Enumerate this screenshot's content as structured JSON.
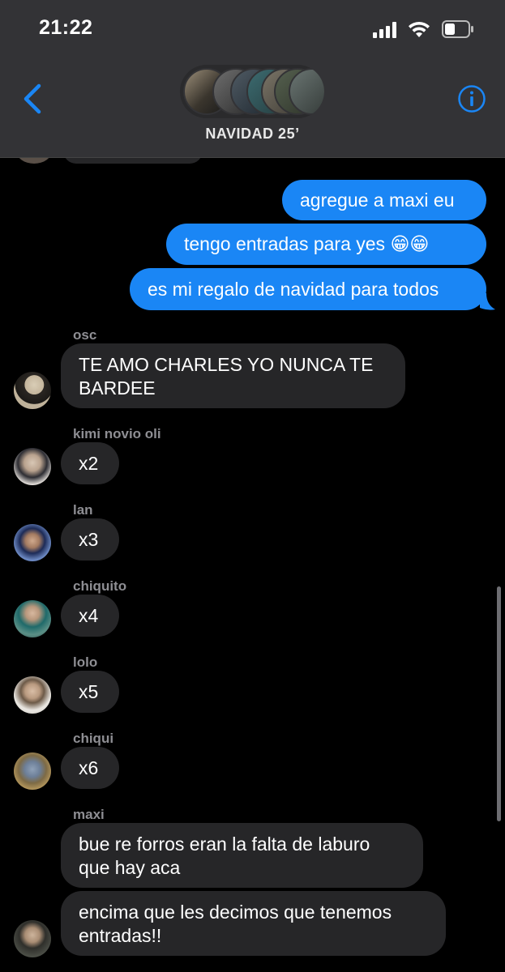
{
  "status_bar": {
    "time": "21:22"
  },
  "header": {
    "group_name": "NAVIDAD 25’",
    "back_icon": "chevron-left-icon",
    "info_icon": "info-icon"
  },
  "colors": {
    "sent_bubble": "#1a86f5",
    "received_bubble": "#262628",
    "accent": "#1a86f5"
  },
  "messages_sent": [
    {
      "text": "agregue a maxi eu"
    },
    {
      "text": "tengo entradas para yes 😁😁"
    },
    {
      "text": "es mi regalo de navidad para todos"
    }
  ],
  "messages_received": [
    {
      "sender": "osc",
      "text": "TE AMO CHARLES YO NUNCA TE\nBARDEE"
    },
    {
      "sender": "kimi novio oli",
      "text": "x2"
    },
    {
      "sender": "lan",
      "text": "x3"
    },
    {
      "sender": "chiquito",
      "text": "x4"
    },
    {
      "sender": "lolo",
      "text": "x5"
    },
    {
      "sender": "chiqui",
      "text": "x6"
    },
    {
      "sender": "maxi",
      "text": "bue re forros eran la falta de laburo\nque hay aca"
    },
    {
      "sender": "",
      "text": "encima que les decimos que tenemos\nentradas!!"
    }
  ]
}
